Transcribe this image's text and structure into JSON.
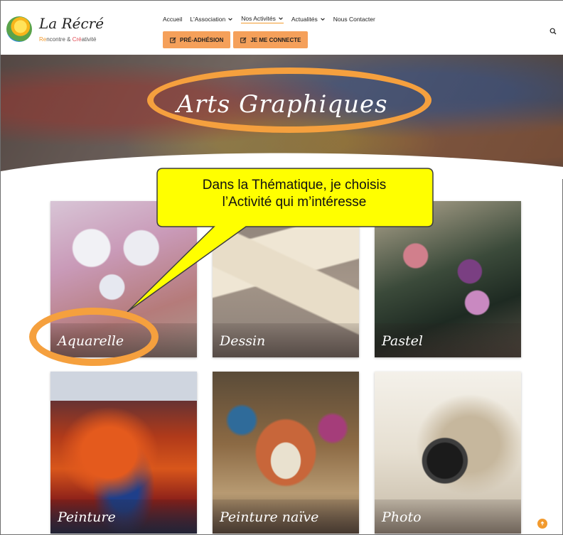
{
  "logo": {
    "title": "La Récré",
    "sub_part1": "Re",
    "sub_part2": "ncontre & ",
    "sub_part3": "Cré",
    "sub_part4": "ativité"
  },
  "nav": {
    "items": [
      {
        "label": "Accueil",
        "dropdown": false
      },
      {
        "label": "L'Association",
        "dropdown": true
      },
      {
        "label": "Nos Activités",
        "dropdown": true,
        "active": true
      },
      {
        "label": "Actualités",
        "dropdown": true
      },
      {
        "label": "Nous Contacter",
        "dropdown": false
      }
    ],
    "buttons": {
      "preadhesion": "PRÉ-ADHÉSION",
      "connect": "JE ME CONNECTE"
    },
    "search_icon": "search-icon"
  },
  "hero": {
    "title": "Arts Graphiques"
  },
  "callout": {
    "line1": "Dans la Thématique, je choisis",
    "line2": "l’Activité qui m’intéresse"
  },
  "activities": [
    {
      "label": "Aquarelle"
    },
    {
      "label": "Dessin"
    },
    {
      "label": "Pastel"
    },
    {
      "label": "Peinture"
    },
    {
      "label": "Peinture naïve"
    },
    {
      "label": "Photo"
    }
  ],
  "colors": {
    "accent": "#f29a2e",
    "button": "#f5a05a",
    "callout": "#ffff00",
    "ring": "#f5a03e"
  }
}
